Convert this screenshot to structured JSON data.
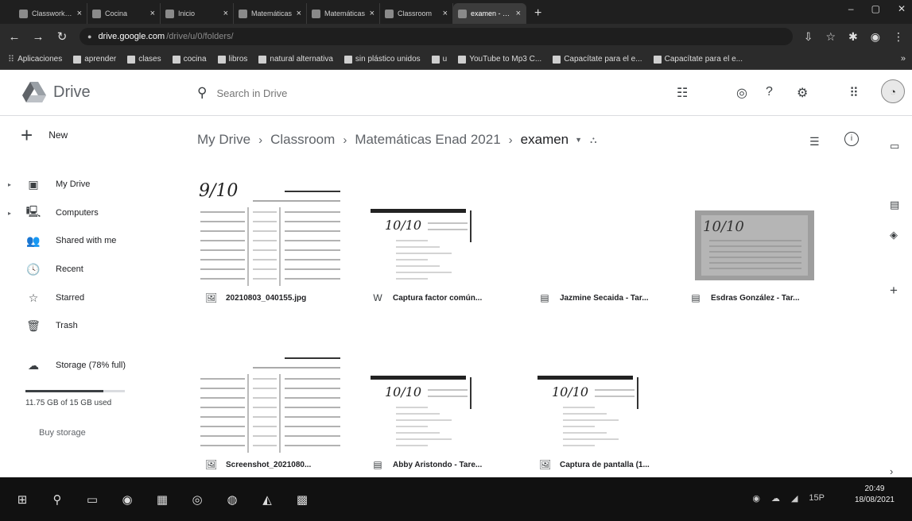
{
  "browser": {
    "tabs": [
      {
        "title": "Classwork for ...",
        "active": false
      },
      {
        "title": "Cocina",
        "active": false
      },
      {
        "title": "Inicio",
        "active": false
      },
      {
        "title": "Matemáticas",
        "active": false
      },
      {
        "title": "Matemáticas",
        "active": false
      },
      {
        "title": "Classroom",
        "active": false
      },
      {
        "title": "examen - Goo",
        "active": true
      }
    ],
    "url_host": "drive.google.com",
    "url_rest": "/drive/u/0/folders/",
    "bookmarks": [
      "Aplicaciones",
      "aprender",
      "clases",
      "cocina",
      "libros",
      "natural alternativa",
      "sin plástico unidos",
      "u",
      "YouTube to Mp3 C...",
      "Capacítate para el e...",
      "Capacítate para el e..."
    ]
  },
  "drive": {
    "logo_text": "Drive",
    "search_placeholder": "Search in Drive",
    "new_label": "New",
    "nav": [
      {
        "label": "My Drive",
        "icon": "my-drive-icon",
        "glyph": "▣",
        "caret": true
      },
      {
        "label": "Computers",
        "icon": "computers-icon",
        "glyph": "🖳",
        "caret": true
      },
      {
        "label": "Shared with me",
        "icon": "shared-icon",
        "glyph": "👥",
        "caret": false
      },
      {
        "label": "Recent",
        "icon": "clock-icon",
        "glyph": "🕓",
        "caret": false
      },
      {
        "label": "Starred",
        "icon": "star-icon",
        "glyph": "☆",
        "caret": false
      },
      {
        "label": "Trash",
        "icon": "trash-icon",
        "glyph": "🗑",
        "caret": false
      },
      {
        "label": "Storage (78% full)",
        "icon": "cloud-icon",
        "glyph": "☁",
        "caret": false
      }
    ],
    "storage_fraction": 0.78,
    "storage_text": "11.75 GB of 15 GB used",
    "buy_storage": "Buy storage",
    "breadcrumb": [
      "My Drive",
      "Classroom",
      "Matemáticas Enad 2021",
      "examen"
    ],
    "files": [
      {
        "name": "20210803_040155.jpg",
        "type": "image",
        "glyph": "🖼",
        "thumb": "table",
        "score": "9/10"
      },
      {
        "name": "Captura factor común...",
        "type": "word",
        "glyph": "W",
        "thumb": "doc",
        "score": "10/10"
      },
      {
        "name": "Jazmine Secaida - Tar...",
        "type": "doc",
        "glyph": "▤",
        "thumb": "blank",
        "score": ""
      },
      {
        "name": "Esdras González - Tar...",
        "type": "doc",
        "glyph": "▤",
        "thumb": "photo",
        "score": "10/10"
      },
      {
        "name": "Screenshot_2021080...",
        "type": "image",
        "glyph": "🖼",
        "thumb": "table2",
        "score": ""
      },
      {
        "name": "Abby Aristondo - Tare...",
        "type": "doc",
        "glyph": "▤",
        "thumb": "doc",
        "score": "10/10"
      },
      {
        "name": "Captura de pantalla (1...",
        "type": "image",
        "glyph": "🖼",
        "thumb": "doc",
        "score": "10/10"
      }
    ]
  },
  "taskbar": {
    "time": "20:49",
    "date": "18/08/2021",
    "temp": "15P"
  }
}
